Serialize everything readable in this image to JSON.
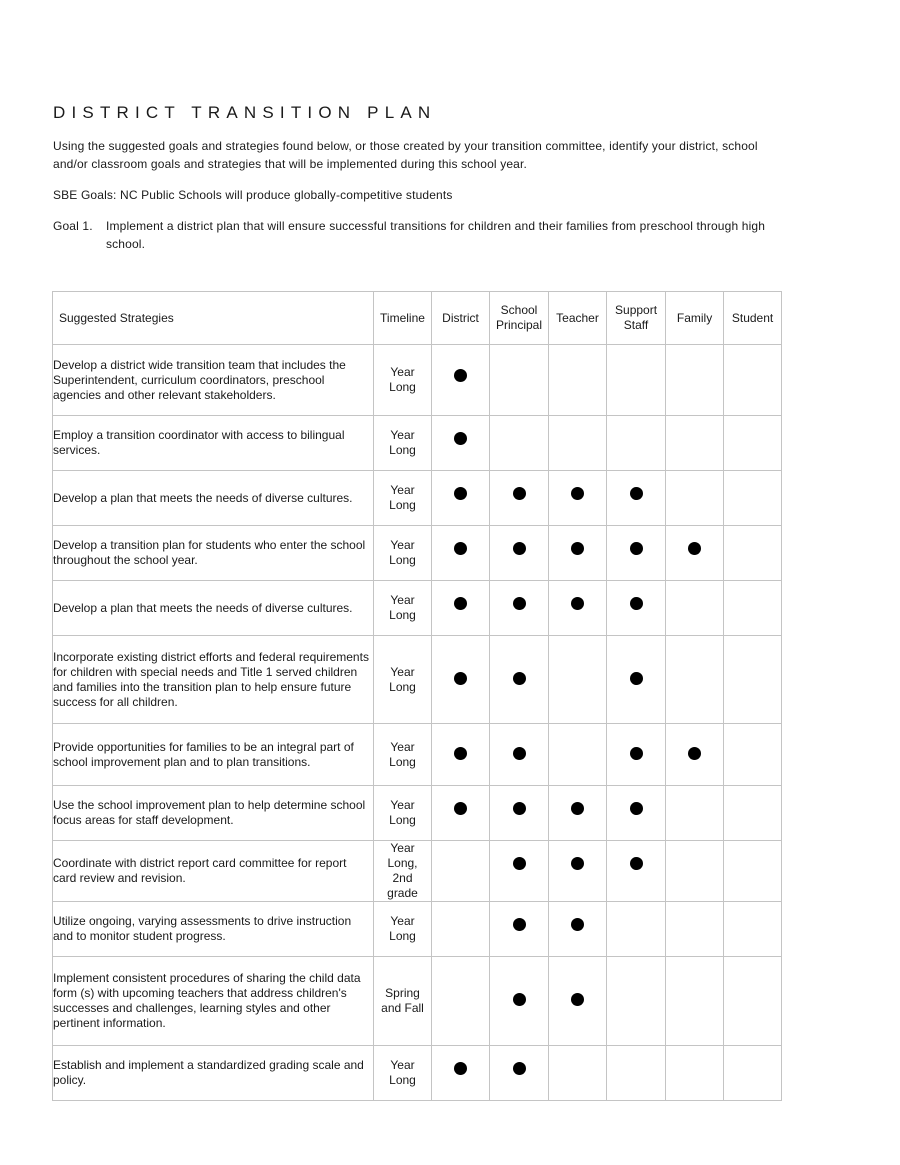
{
  "document": {
    "title": "DISTRICT TRANSITION PLAN",
    "intro": "Using the suggested goals and strategies found below, or those created by your transition committee, identify your district, school and/or classroom goals and strategies that will be implemented during this school year.",
    "sbe_goals": "SBE Goals:  NC Public Schools will produce globally-competitive students",
    "goal": {
      "label": "Goal 1.",
      "text": "Implement a district plan that will ensure successful transitions for children and their families from preschool through high school."
    }
  },
  "table": {
    "headers": {
      "strategy": "Suggested Strategies",
      "timeline": "Timeline",
      "district": "District",
      "school_principal": "School Principal",
      "teacher": "Teacher",
      "support_staff": "Support Staff",
      "family": "Family",
      "student": "Student"
    },
    "role_keys": [
      "district",
      "school_principal",
      "teacher",
      "support_staff",
      "family",
      "student"
    ],
    "rows": [
      {
        "strategy": "Develop a district wide transition team that includes the Superintendent, curriculum coordinators, preschool agencies and other relevant stakeholders.",
        "timeline": "Year Long",
        "marks": {
          "district": true,
          "school_principal": false,
          "teacher": false,
          "support_staff": false,
          "family": false,
          "student": false
        },
        "mark_valign": "upper"
      },
      {
        "strategy": "Employ a transition coordinator with access to bilingual services.",
        "timeline": "Year Long",
        "marks": {
          "district": true,
          "school_principal": false,
          "teacher": false,
          "support_staff": false,
          "family": false,
          "student": false
        },
        "mark_valign": "upper"
      },
      {
        "strategy": "Develop a plan that meets the needs of diverse cultures.",
        "timeline": "Year Long",
        "marks": {
          "district": true,
          "school_principal": true,
          "teacher": true,
          "support_staff": true,
          "family": false,
          "student": false
        },
        "mark_valign": "upper"
      },
      {
        "strategy": "Develop a transition plan for students who enter the school throughout the school year.",
        "timeline": "Year Long",
        "marks": {
          "district": true,
          "school_principal": true,
          "teacher": true,
          "support_staff": true,
          "family": true,
          "student": false
        },
        "mark_valign": "upper"
      },
      {
        "strategy": "Develop a plan that meets the needs of diverse cultures.",
        "timeline": "Year Long",
        "marks": {
          "district": true,
          "school_principal": true,
          "teacher": true,
          "support_staff": true,
          "family": false,
          "student": false
        },
        "mark_valign": "upper"
      },
      {
        "strategy": "Incorporate existing district efforts and federal requirements for children with special needs and Title 1 served children and families into the transition plan to help ensure future success for all children.",
        "timeline": "Year Long",
        "marks": {
          "district": true,
          "school_principal": true,
          "teacher": false,
          "support_staff": true,
          "family": false,
          "student": false
        },
        "mark_valign": "middle"
      },
      {
        "strategy": "Provide opportunities for families to be an integral part of school improvement plan and to plan transitions.",
        "timeline": "Year Long",
        "marks": {
          "district": true,
          "school_principal": true,
          "teacher": false,
          "support_staff": true,
          "family": true,
          "student": false
        },
        "mark_valign": "middle"
      },
      {
        "strategy": "Use the school improvement plan to help determine school focus areas for staff development.",
        "timeline": "Year Long",
        "marks": {
          "district": true,
          "school_principal": true,
          "teacher": true,
          "support_staff": true,
          "family": false,
          "student": false
        },
        "mark_valign": "upper"
      },
      {
        "strategy": "Coordinate with district report card committee for report card review and revision.",
        "timeline": "Year Long, 2nd grade",
        "marks": {
          "district": false,
          "school_principal": true,
          "teacher": true,
          "support_staff": true,
          "family": false,
          "student": false
        },
        "mark_valign": "upper"
      },
      {
        "strategy": "Utilize ongoing, varying assessments to drive instruction and to monitor student progress.",
        "timeline": "Year Long",
        "marks": {
          "district": false,
          "school_principal": true,
          "teacher": true,
          "support_staff": false,
          "family": false,
          "student": false
        },
        "mark_valign": "upper"
      },
      {
        "strategy": "Implement consistent procedures of sharing the child data form (s) with upcoming teachers that address children's successes and challenges, learning styles and other pertinent information.",
        "timeline": "Spring and Fall",
        "marks": {
          "district": false,
          "school_principal": true,
          "teacher": true,
          "support_staff": false,
          "family": false,
          "student": false
        },
        "mark_valign": "middle"
      },
      {
        "strategy": "Establish and implement a standardized grading scale and policy.",
        "timeline": "Year Long",
        "marks": {
          "district": true,
          "school_principal": true,
          "teacher": false,
          "support_staff": false,
          "family": false,
          "student": false
        },
        "mark_valign": "upper"
      }
    ]
  }
}
